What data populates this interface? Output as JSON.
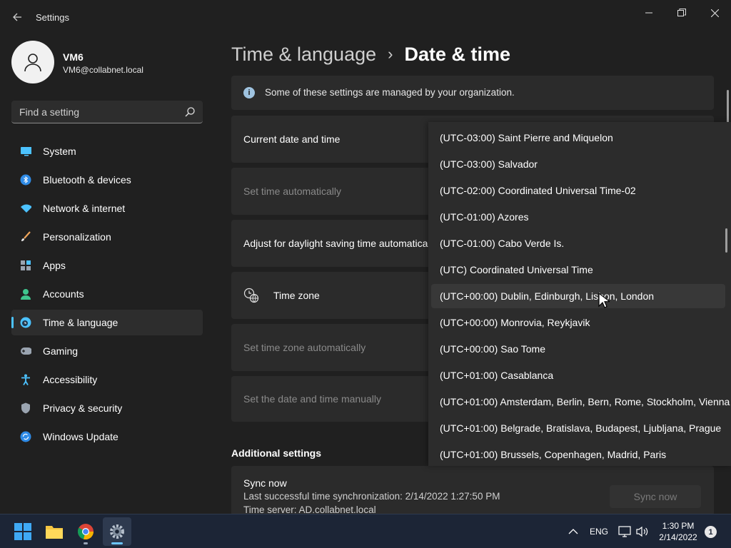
{
  "window": {
    "app_title": "Settings",
    "controls": {
      "minimize": "minimize",
      "maximize": "maximize",
      "close": "close"
    }
  },
  "user": {
    "name": "VM6",
    "email": "VM6@collabnet.local"
  },
  "search": {
    "placeholder": "Find a setting"
  },
  "sidebar": {
    "items": [
      {
        "label": "System",
        "icon": "system-icon"
      },
      {
        "label": "Bluetooth & devices",
        "icon": "bluetooth-icon"
      },
      {
        "label": "Network & internet",
        "icon": "wifi-icon"
      },
      {
        "label": "Personalization",
        "icon": "brush-icon"
      },
      {
        "label": "Apps",
        "icon": "apps-icon"
      },
      {
        "label": "Accounts",
        "icon": "accounts-icon"
      },
      {
        "label": "Time & language",
        "icon": "time-language-icon",
        "selected": true
      },
      {
        "label": "Gaming",
        "icon": "gamepad-icon"
      },
      {
        "label": "Accessibility",
        "icon": "accessibility-icon"
      },
      {
        "label": "Privacy & security",
        "icon": "shield-icon"
      },
      {
        "label": "Windows Update",
        "icon": "update-icon"
      }
    ]
  },
  "header": {
    "parent": "Time & language",
    "separator": "›",
    "current": "Date & time"
  },
  "info": {
    "text": "Some of these settings are managed by your organization."
  },
  "cards": {
    "current_date_time": "Current date and time",
    "set_time_auto": "Set time automatically",
    "daylight_saving": "Adjust for daylight saving time automatically",
    "time_zone": "Time zone",
    "set_tz_auto": "Set time zone automatically",
    "set_manually": "Set the date and time manually"
  },
  "additional": {
    "title": "Additional settings",
    "sync_title": "Sync now",
    "last_sync": "Last successful time synchronization: 2/14/2022 1:27:50 PM",
    "server": "Time server: AD.collabnet.local",
    "sync_button": "Sync now"
  },
  "timezone_dropdown": {
    "hovered_index": 6,
    "options": [
      "(UTC-03:00) Saint Pierre and Miquelon",
      "(UTC-03:00) Salvador",
      "(UTC-02:00) Coordinated Universal Time-02",
      "(UTC-01:00) Azores",
      "(UTC-01:00) Cabo Verde Is.",
      "(UTC) Coordinated Universal Time",
      "(UTC+00:00) Dublin, Edinburgh, Lisbon, London",
      "(UTC+00:00) Monrovia, Reykjavik",
      "(UTC+00:00) Sao Tome",
      "(UTC+01:00) Casablanca",
      "(UTC+01:00) Amsterdam, Berlin, Bern, Rome, Stockholm, Vienna",
      "(UTC+01:00) Belgrade, Bratislava, Budapest, Ljubljana, Prague",
      "(UTC+01:00) Brussels, Copenhagen, Madrid, Paris"
    ]
  },
  "taskbar": {
    "apps": [
      "start-icon",
      "file-explorer-icon",
      "chrome-icon",
      "settings-icon"
    ],
    "language": "ENG",
    "time": "1:30 PM",
    "date": "2/14/2022",
    "notifications": "1"
  },
  "colors": {
    "accent": "#4cc2ff",
    "background": "#202020",
    "card": "#2b2b2b",
    "taskbar": "#1c2536"
  }
}
